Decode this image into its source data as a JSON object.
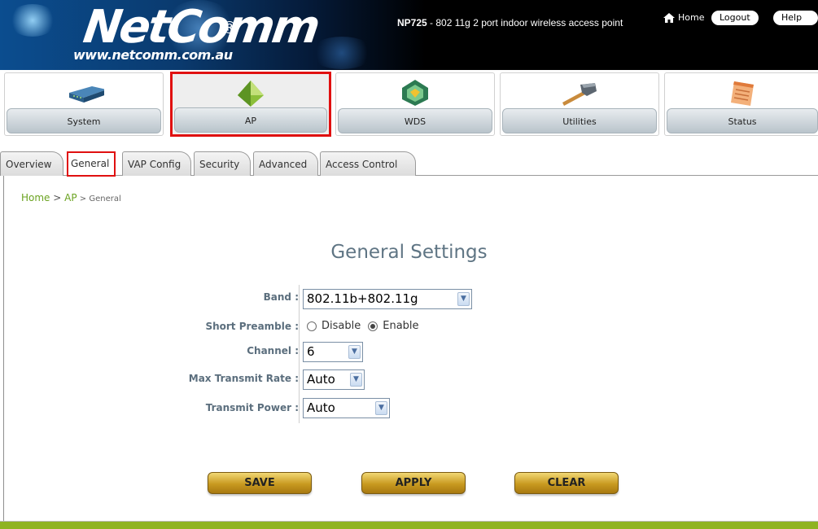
{
  "header": {
    "logo_text": "NetComm",
    "logo_reg": "®",
    "logo_url": "www.netcomm.com.au",
    "product_model": "NP725",
    "product_desc": " - 802 11g 2 port indoor wireless access point",
    "home_label": "Home",
    "logout_label": "Logout",
    "help_label": "Help"
  },
  "modules": [
    {
      "label": "System",
      "icon": "device-icon"
    },
    {
      "label": "AP",
      "icon": "ap-icon",
      "active": true
    },
    {
      "label": "WDS",
      "icon": "wds-icon"
    },
    {
      "label": "Utilities",
      "icon": "hammer-icon"
    },
    {
      "label": "Status",
      "icon": "notepad-icon"
    }
  ],
  "tabs": [
    {
      "label": "Overview"
    },
    {
      "label": "General",
      "active": true
    },
    {
      "label": "VAP Config"
    },
    {
      "label": "Security"
    },
    {
      "label": "Advanced"
    },
    {
      "label": "Access Control"
    }
  ],
  "breadcrumb": {
    "home": "Home",
    "sep1": " > ",
    "ap": "AP",
    "sep2": " > ",
    "current": "General"
  },
  "page_title": "General Settings",
  "form": {
    "band_label": "Band :",
    "band_value": "802.11b+802.11g",
    "preamble_label": "Short Preamble :",
    "preamble_disable": "Disable",
    "preamble_enable": "Enable",
    "preamble_selected": "Enable",
    "channel_label": "Channel :",
    "channel_value": "6",
    "rate_label": "Max Transmit Rate :",
    "rate_value": "Auto",
    "power_label": "Transmit Power :",
    "power_value": "Auto"
  },
  "buttons": {
    "save": "SAVE",
    "apply": "APPLY",
    "clear": "CLEAR"
  },
  "colors": {
    "accent_green": "#8fb323",
    "highlight_red": "#e01010",
    "label_blue": "#5b6e7d",
    "button_gold": "#c89a20"
  }
}
